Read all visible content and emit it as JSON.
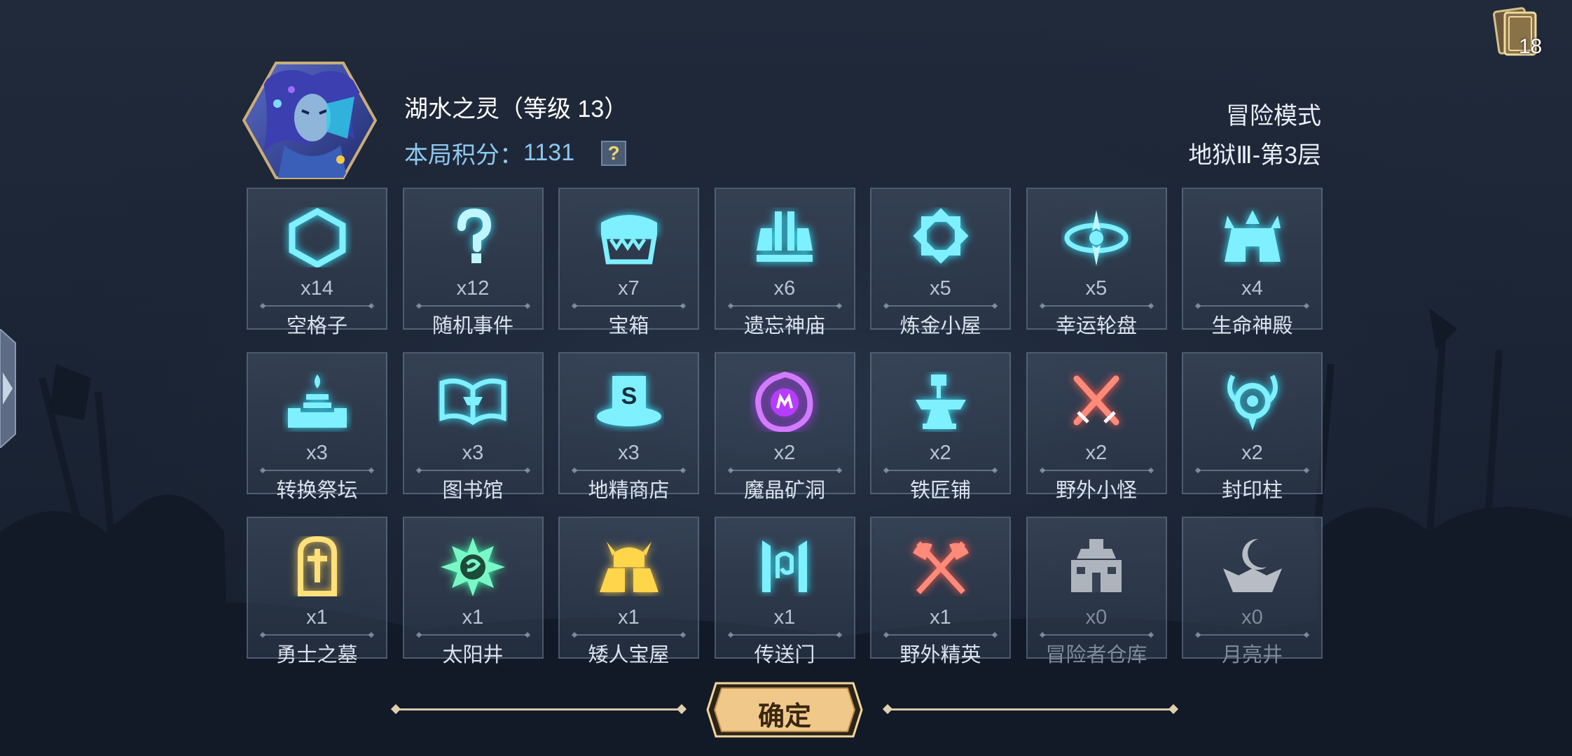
{
  "deck": {
    "icon": "card-deck-icon",
    "count": "18"
  },
  "hero": {
    "name": "湖水之灵（等级 13）",
    "score_label": "本局积分：",
    "score_value": "1131",
    "help": "?"
  },
  "mode": {
    "title": "冒险模式",
    "floor": "地狱Ⅲ-第3层"
  },
  "colors": {
    "accent_cyan": "#33e6ff",
    "accent_gold": "#f4c948",
    "accent_red": "#ff5a4a",
    "accent_purple": "#b83cff",
    "accent_green": "#3df2a0"
  },
  "cells": [
    {
      "icon": "hexagon-icon",
      "count": "x14",
      "label": "空格子"
    },
    {
      "icon": "question-mark-icon",
      "count": "x12",
      "label": "随机事件"
    },
    {
      "icon": "treasure-chest-icon",
      "count": "x7",
      "label": "宝箱"
    },
    {
      "icon": "forgotten-temple-icon",
      "count": "x6",
      "label": "遗忘神庙"
    },
    {
      "icon": "alchemy-diamond-icon",
      "count": "x5",
      "label": "炼金小屋"
    },
    {
      "icon": "lucky-wheel-icon",
      "count": "x5",
      "label": "幸运轮盘"
    },
    {
      "icon": "life-temple-icon",
      "count": "x4",
      "label": "生命神殿"
    },
    {
      "icon": "altar-icon",
      "count": "x3",
      "label": "转换祭坛"
    },
    {
      "icon": "open-book-icon",
      "count": "x3",
      "label": "图书馆"
    },
    {
      "icon": "goblin-shop-icon",
      "count": "x3",
      "label": "地精商店"
    },
    {
      "icon": "magic-crystal-icon",
      "count": "x2",
      "label": "魔晶矿洞"
    },
    {
      "icon": "anvil-hammer-icon",
      "count": "x2",
      "label": "铁匠铺"
    },
    {
      "icon": "crossed-swords-icon",
      "count": "x2",
      "label": "野外小怪"
    },
    {
      "icon": "sealed-pillar-icon",
      "count": "x2",
      "label": "封印柱"
    },
    {
      "icon": "tombstone-icon",
      "count": "x1",
      "label": "勇士之墓"
    },
    {
      "icon": "sun-well-icon",
      "count": "x1",
      "label": "太阳井"
    },
    {
      "icon": "dwarf-house-icon",
      "count": "x1",
      "label": "矮人宝屋"
    },
    {
      "icon": "portal-icon",
      "count": "x1",
      "label": "传送门"
    },
    {
      "icon": "crossed-axes-icon",
      "count": "x1",
      "label": "野外精英"
    },
    {
      "icon": "warehouse-icon",
      "count": "x0",
      "label": "冒险者仓库"
    },
    {
      "icon": "moon-well-icon",
      "count": "x0",
      "label": "月亮井"
    }
  ],
  "confirm_label": "确定"
}
